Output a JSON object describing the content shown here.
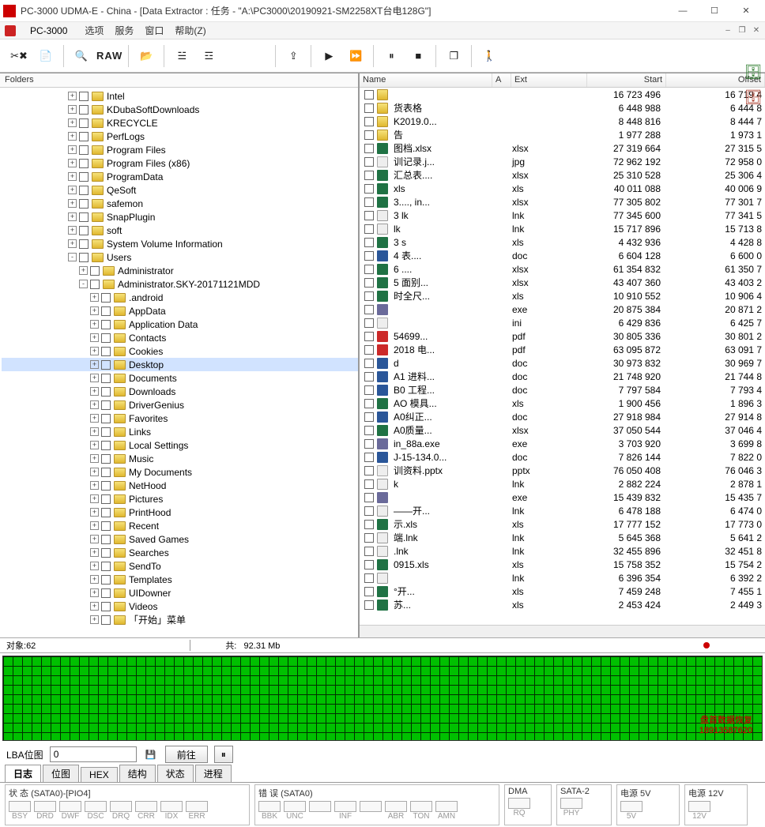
{
  "window": {
    "title": "PC-3000 UDMA-E - China - [Data Extractor : 任务 - \"A:\\PC3000\\20190921-SM2258XT台电128G\"]",
    "min": "—",
    "max": "☐",
    "close": "✕"
  },
  "menubar": {
    "app": "PC-3000",
    "items": [
      "选项",
      "服务",
      "窗口",
      "帮助(Z)"
    ]
  },
  "toolbar": {
    "tools_icon": "✕✕",
    "props_icon": "📄",
    "search_icon": "🔎",
    "raw": "RAW",
    "folder_icon": "📁",
    "hier1_icon": "☷",
    "hier2_icon": "☷",
    "export_icon": "⇪",
    "play_icon": "▶",
    "step_icon": "⏭",
    "pause_icon": "⏸",
    "stop_icon": "■",
    "copy_icon": "❐",
    "person_icon": "🚶"
  },
  "side": {
    "db_icon": "🗄",
    "dbx_icon": "🗄✕"
  },
  "left": {
    "header": "Folders",
    "tree": [
      {
        "d": 6,
        "label": "Intel",
        "exp": "+"
      },
      {
        "d": 6,
        "label": "KDubaSoftDownloads",
        "exp": "+"
      },
      {
        "d": 6,
        "label": "KRECYCLE",
        "exp": "+"
      },
      {
        "d": 6,
        "label": "PerfLogs",
        "exp": "+"
      },
      {
        "d": 6,
        "label": "Program Files",
        "exp": "+"
      },
      {
        "d": 6,
        "label": "Program Files (x86)",
        "exp": "+"
      },
      {
        "d": 6,
        "label": "ProgramData",
        "exp": "+"
      },
      {
        "d": 6,
        "label": "QeSoft",
        "exp": "+"
      },
      {
        "d": 6,
        "label": "safemon",
        "exp": "+"
      },
      {
        "d": 6,
        "label": "SnapPlugin",
        "exp": "+"
      },
      {
        "d": 6,
        "label": "soft",
        "exp": "+"
      },
      {
        "d": 6,
        "label": "System Volume Information",
        "exp": "+"
      },
      {
        "d": 6,
        "label": "Users",
        "exp": "-"
      },
      {
        "d": 7,
        "label": "Administrator",
        "exp": "+"
      },
      {
        "d": 7,
        "label": "Administrator.SKY-20171121MDD",
        "exp": "-"
      },
      {
        "d": 8,
        "label": ".android",
        "exp": "+"
      },
      {
        "d": 8,
        "label": "AppData",
        "exp": "+"
      },
      {
        "d": 8,
        "label": "Application Data",
        "exp": "+"
      },
      {
        "d": 8,
        "label": "Contacts",
        "exp": "+"
      },
      {
        "d": 8,
        "label": "Cookies",
        "exp": "+"
      },
      {
        "d": 8,
        "label": "Desktop",
        "exp": "+",
        "sel": true
      },
      {
        "d": 8,
        "label": "Documents",
        "exp": "+"
      },
      {
        "d": 8,
        "label": "Downloads",
        "exp": "+"
      },
      {
        "d": 8,
        "label": "DriverGenius",
        "exp": "+"
      },
      {
        "d": 8,
        "label": "Favorites",
        "exp": "+"
      },
      {
        "d": 8,
        "label": "Links",
        "exp": "+"
      },
      {
        "d": 8,
        "label": "Local Settings",
        "exp": "+"
      },
      {
        "d": 8,
        "label": "Music",
        "exp": "+"
      },
      {
        "d": 8,
        "label": "My Documents",
        "exp": "+"
      },
      {
        "d": 8,
        "label": "NetHood",
        "exp": "+"
      },
      {
        "d": 8,
        "label": "Pictures",
        "exp": "+"
      },
      {
        "d": 8,
        "label": "PrintHood",
        "exp": "+"
      },
      {
        "d": 8,
        "label": "Recent",
        "exp": "+"
      },
      {
        "d": 8,
        "label": "Saved Games",
        "exp": "+"
      },
      {
        "d": 8,
        "label": "Searches",
        "exp": "+"
      },
      {
        "d": 8,
        "label": "SendTo",
        "exp": "+"
      },
      {
        "d": 8,
        "label": "Templates",
        "exp": "+"
      },
      {
        "d": 8,
        "label": "UIDowner",
        "exp": "+"
      },
      {
        "d": 8,
        "label": "Videos",
        "exp": "+"
      },
      {
        "d": 8,
        "label": "「开始」菜单",
        "exp": "+"
      }
    ]
  },
  "right": {
    "cols": {
      "name": "Name",
      "a": "A",
      "ext": "Ext",
      "start": "Start",
      "offset": "Offset"
    },
    "rows": [
      {
        "icon": "folder",
        "name": "",
        "ext": "",
        "start": "16 723 496",
        "offset": "16 719 4"
      },
      {
        "icon": "folder",
        "name": "货表格",
        "ext": "",
        "start": "6 448 988",
        "offset": "6 444 8"
      },
      {
        "icon": "folder",
        "name": "K2019.0...",
        "ext": "",
        "start": "8 448 816",
        "offset": "8 444 7"
      },
      {
        "icon": "folder",
        "name": "告",
        "ext": "",
        "start": "1 977 288",
        "offset": "1 973 1"
      },
      {
        "icon": "xlsx",
        "name": "图档.xlsx",
        "ext": "xlsx",
        "start": "27 319 664",
        "offset": "27 315 5"
      },
      {
        "icon": "generic",
        "name": "训记录.j...",
        "ext": "jpg",
        "start": "72 962 192",
        "offset": "72 958 0"
      },
      {
        "icon": "xlsx",
        "name": "汇总表....",
        "ext": "xlsx",
        "start": "25 310 528",
        "offset": "25 306 4"
      },
      {
        "icon": "xlsx",
        "name": "xls",
        "ext": "xls",
        "start": "40 011 088",
        "offset": "40 006 9"
      },
      {
        "icon": "xlsx",
        "name": "3...., in...",
        "ext": "xlsx",
        "start": "77 305 802",
        "offset": "77 301 7"
      },
      {
        "icon": "lnk",
        "name": "3     lk",
        "ext": "lnk",
        "start": "77 345 600",
        "offset": "77 341 5"
      },
      {
        "icon": "lnk",
        "name": "lk",
        "ext": "lnk",
        "start": "15 717 896",
        "offset": "15 713 8"
      },
      {
        "icon": "xlsx",
        "name": "3   s",
        "ext": "xls",
        "start": "4 432 936",
        "offset": "4 428 8"
      },
      {
        "icon": "doc",
        "name": "4   表....",
        "ext": "doc",
        "start": "6 604 128",
        "offset": "6 600 0"
      },
      {
        "icon": "xlsx",
        "name": "6   ....",
        "ext": "xlsx",
        "start": "61 354 832",
        "offset": "61 350 7"
      },
      {
        "icon": "xlsx",
        "name": "5   面别...",
        "ext": "xlsx",
        "start": "43 407 360",
        "offset": "43 403 2"
      },
      {
        "icon": "xlsx",
        "name": "时全尺...",
        "ext": "xls",
        "start": "10 910 552",
        "offset": "10 906 4"
      },
      {
        "icon": "exe",
        "name": "",
        "ext": "exe",
        "start": "20 875 384",
        "offset": "20 871 2"
      },
      {
        "icon": "generic",
        "name": "",
        "ext": "ini",
        "start": "6 429 836",
        "offset": "6 425 7"
      },
      {
        "icon": "pdf",
        "name": "54699...",
        "ext": "pdf",
        "start": "30 805 336",
        "offset": "30 801 2"
      },
      {
        "icon": "pdf",
        "name": "2018 电...",
        "ext": "pdf",
        "start": "63 095 872",
        "offset": "63 091 7"
      },
      {
        "icon": "doc",
        "name": "d",
        "ext": "doc",
        "start": "30 973 832",
        "offset": "30 969 7"
      },
      {
        "icon": "doc",
        "name": "A1 进料...",
        "ext": "doc",
        "start": "21 748 920",
        "offset": "21 744 8"
      },
      {
        "icon": "doc",
        "name": "B0 工程...",
        "ext": "doc",
        "start": "7 797 584",
        "offset": "7 793 4"
      },
      {
        "icon": "xlsx",
        "name": "AO 模具...",
        "ext": "xls",
        "start": "1 900 456",
        "offset": "1 896 3"
      },
      {
        "icon": "doc",
        "name": "A0纠正...",
        "ext": "doc",
        "start": "27 918 984",
        "offset": "27 914 8"
      },
      {
        "icon": "xlsx",
        "name": "A0质量...",
        "ext": "xlsx",
        "start": "37 050 544",
        "offset": "37 046 4"
      },
      {
        "icon": "exe",
        "name": "in_88a.exe",
        "ext": "exe",
        "start": "3 703 920",
        "offset": "3 699 8"
      },
      {
        "icon": "doc",
        "name": "J-15-134.0...",
        "ext": "doc",
        "start": "7 826 144",
        "offset": "7 822 0"
      },
      {
        "icon": "generic",
        "name": "训资料.pptx",
        "ext": "pptx",
        "start": "76 050 408",
        "offset": "76 046 3"
      },
      {
        "icon": "lnk",
        "name": "k",
        "ext": "lnk",
        "start": "2 882 224",
        "offset": "2 878 1"
      },
      {
        "icon": "exe",
        "name": "",
        "ext": "exe",
        "start": "15 439 832",
        "offset": "15 435 7"
      },
      {
        "icon": "lnk",
        "name": "——开...",
        "ext": "lnk",
        "start": "6 478 188",
        "offset": "6 474 0"
      },
      {
        "icon": "xlsx",
        "name": "示.xls",
        "ext": "xls",
        "start": "17 777 152",
        "offset": "17 773 0"
      },
      {
        "icon": "lnk",
        "name": "端.lnk",
        "ext": "lnk",
        "start": "5 645 368",
        "offset": "5 641 2"
      },
      {
        "icon": "lnk",
        "name": ".lnk",
        "ext": "lnk",
        "start": "32 455 896",
        "offset": "32 451 8"
      },
      {
        "icon": "xlsx",
        "name": "0915.xls",
        "ext": "xls",
        "start": "15 758 352",
        "offset": "15 754 2"
      },
      {
        "icon": "lnk",
        "name": "",
        "ext": "lnk",
        "start": "6 396 354",
        "offset": "6 392 2"
      },
      {
        "icon": "xlsx",
        "name": "°开...",
        "ext": "xls",
        "start": "7 459 248",
        "offset": "7 455 1"
      },
      {
        "icon": "xlsx",
        "name": "苏...",
        "ext": "xls",
        "start": "2 453 424",
        "offset": "2 449 3"
      }
    ]
  },
  "status": {
    "objects_label": "对象:",
    "objects_val": "62",
    "total_label": "共:",
    "total_val": "92.31 Mb"
  },
  "watermark": {
    "line1": "盘首数据恢复",
    "line2": "18913587620"
  },
  "lba": {
    "label": "LBA位图",
    "value": "0",
    "goto": "前往",
    "pause": "⏸"
  },
  "tabs": [
    "日志",
    "位图",
    "HEX",
    "结构",
    "状态",
    "进程"
  ],
  "active_tab": 0,
  "bottom": {
    "status_grp": {
      "title": "状 态 (SATA0)-[PIO4]",
      "leds": [
        "BSY",
        "DRD",
        "DWF",
        "DSC",
        "DRQ",
        "CRR",
        "IDX",
        "ERR"
      ]
    },
    "error_grp": {
      "title": "错 误 (SATA0)",
      "leds": [
        "BBK",
        "UNC",
        "",
        "INF",
        "",
        "ABR",
        "TON",
        "AMN"
      ]
    },
    "dma": {
      "title": "DMA",
      "led": "RQ"
    },
    "sata2": {
      "title": "SATA-2",
      "led": "PHY"
    },
    "pwr5": {
      "title": "电源 5V",
      "led": "5V"
    },
    "pwr12": {
      "title": "电源 12V",
      "led": "12V"
    }
  }
}
